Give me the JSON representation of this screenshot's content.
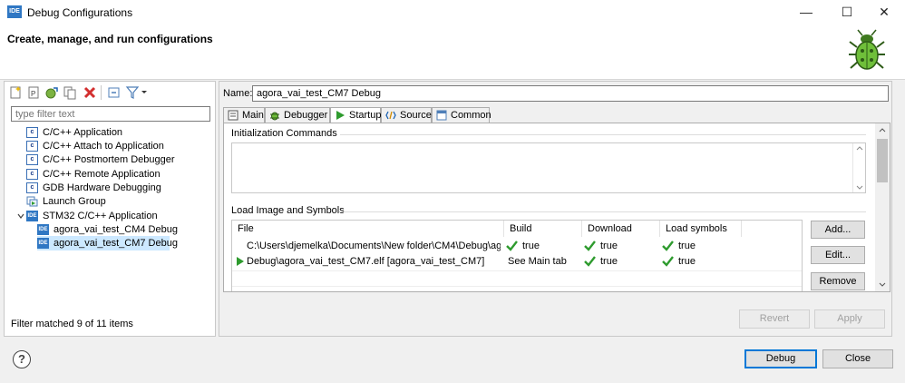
{
  "window": {
    "title": "Debug Configurations",
    "banner_title": "Create, manage, and run configurations"
  },
  "filter": {
    "placeholder": "type filter text"
  },
  "tree": [
    {
      "label": "C/C++ Application",
      "icon": "c-icon"
    },
    {
      "label": "C/C++ Attach to Application",
      "icon": "c-icon"
    },
    {
      "label": "C/C++ Postmortem Debugger",
      "icon": "c-icon"
    },
    {
      "label": "C/C++ Remote Application",
      "icon": "c-icon"
    },
    {
      "label": "GDB Hardware Debugging",
      "icon": "c-icon"
    },
    {
      "label": "Launch Group",
      "icon": "launch-group-icon"
    },
    {
      "label": "STM32 C/C++ Application",
      "icon": "ide-icon"
    },
    {
      "label": "agora_vai_test_CM4 Debug",
      "icon": "ide-icon"
    },
    {
      "label": "agora_vai_test_CM7 Debug",
      "icon": "ide-icon",
      "selected": true
    }
  ],
  "filter_status": "Filter matched 9 of 11 items",
  "config": {
    "name_label": "Name:",
    "name_value": "agora_vai_test_CM7 Debug"
  },
  "tabs": [
    {
      "label": "Main"
    },
    {
      "label": "Debugger"
    },
    {
      "label": "Startup",
      "active": true
    },
    {
      "label": "Source"
    },
    {
      "label": "Common"
    }
  ],
  "startup": {
    "init_title": "Initialization Commands",
    "load_title": "Load Image and Symbols",
    "columns": [
      "File",
      "Build",
      "Download",
      "Load symbols"
    ],
    "rows": [
      {
        "file": "C:\\Users\\djemelka\\Documents\\New folder\\CM4\\Debug\\ag...",
        "build": "true",
        "download": "true",
        "load_symbols": "true"
      },
      {
        "file": "Debug\\agora_vai_test_CM7.elf [agora_vai_test_CM7]",
        "build": "See Main tab",
        "download": "true",
        "load_symbols": "true"
      }
    ],
    "add_label": "Add...",
    "edit_label": "Edit...",
    "remove_label": "Remove"
  },
  "buttons": {
    "revert": "Revert",
    "apply": "Apply",
    "debug": "Debug",
    "close": "Close"
  },
  "colors": {
    "ide_blue": "#2f77c3",
    "check_green": "#2e9b2e",
    "selection": "#cce8ff"
  }
}
